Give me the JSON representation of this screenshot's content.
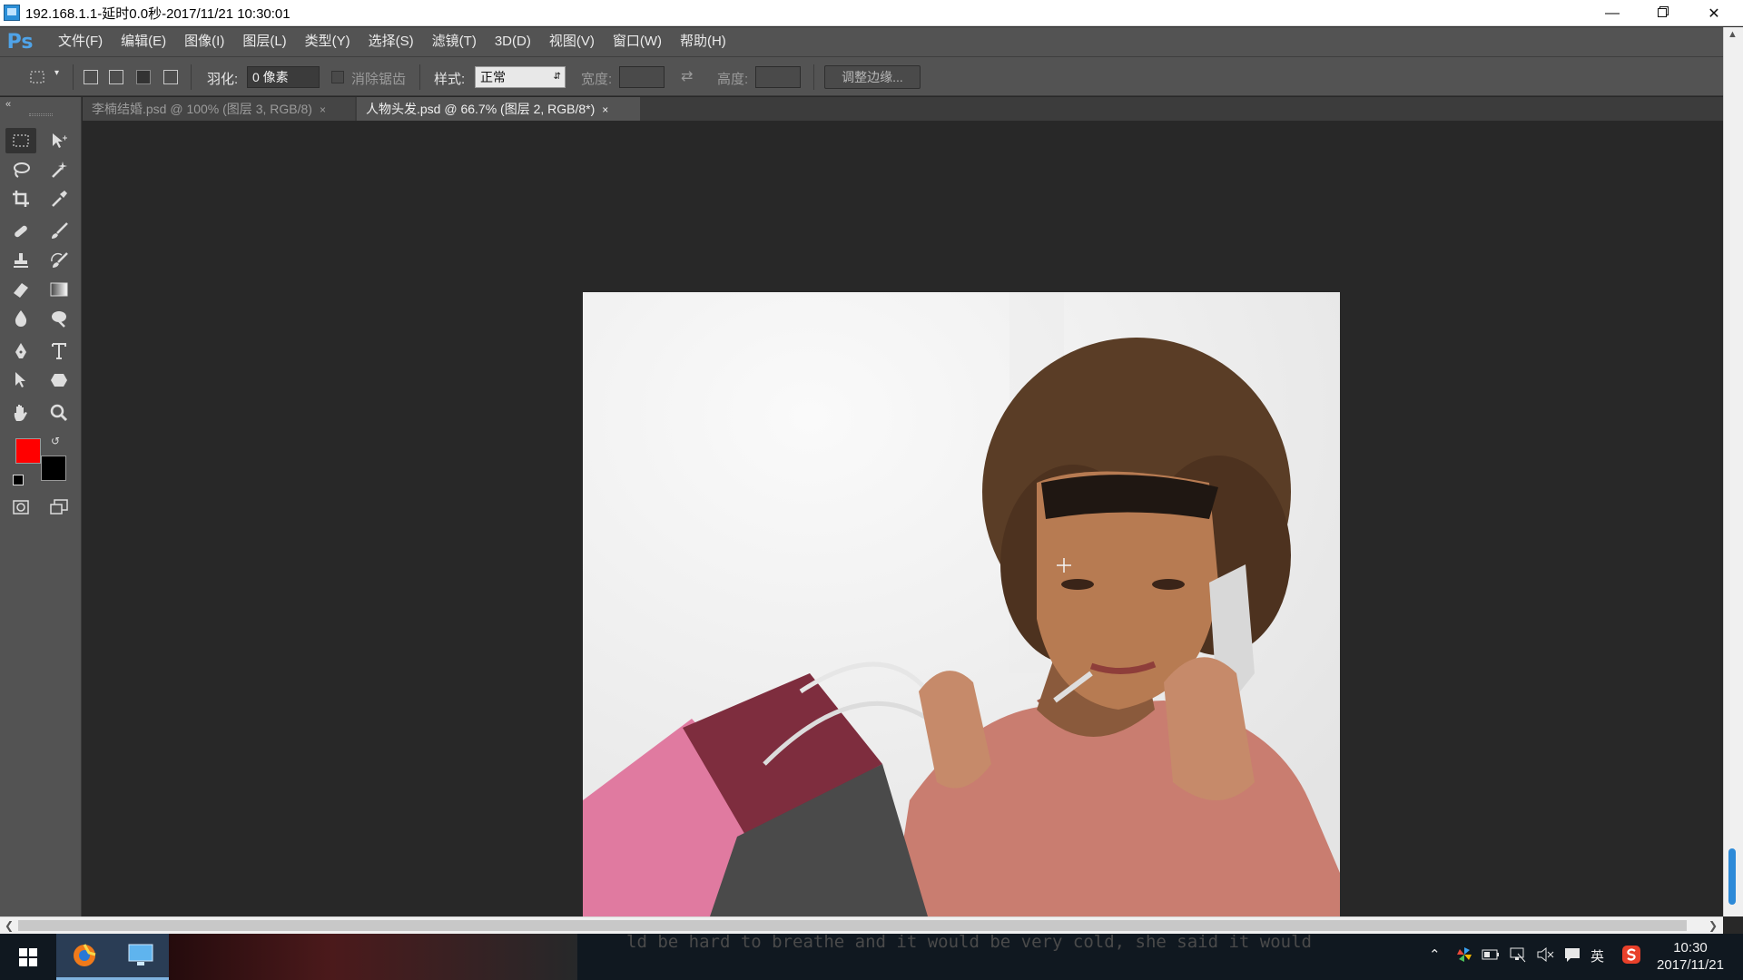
{
  "window": {
    "title": "192.168.1.1-延时0.0秒-2017/11/21 10:30:01",
    "minimize_icon": "minimize-icon",
    "restore_icon": "restore-icon",
    "close_icon": "close-icon"
  },
  "app": {
    "logo": "Ps",
    "menu": [
      "文件(F)",
      "编辑(E)",
      "图像(I)",
      "图层(L)",
      "类型(Y)",
      "选择(S)",
      "滤镜(T)",
      "3D(D)",
      "视图(V)",
      "窗口(W)",
      "帮助(H)"
    ]
  },
  "options": {
    "feather_label": "羽化:",
    "feather_value": "0 像素",
    "antialias_label": "消除锯齿",
    "style_label": "样式:",
    "style_value": "正常",
    "width_label": "宽度:",
    "height_label": "高度:",
    "refine_edge_label": "调整边缘..."
  },
  "tabs": [
    {
      "label": "李楠结婚.psd @ 100% (图层 3, RGB/8)",
      "close": "×",
      "active": false
    },
    {
      "label": "人物头发.psd @ 66.7% (图层 2, RGB/8*)",
      "close": "×",
      "active": true
    }
  ],
  "colors": {
    "foreground": "#ff0000",
    "background": "#000000",
    "accent": "#4fa3e8"
  },
  "taskbar": {
    "background_text": "ld be hard to breathe and it would be very cold, she said it would",
    "tray_language": "英",
    "clock_time": "10:30",
    "clock_date": "2017/11/21"
  }
}
